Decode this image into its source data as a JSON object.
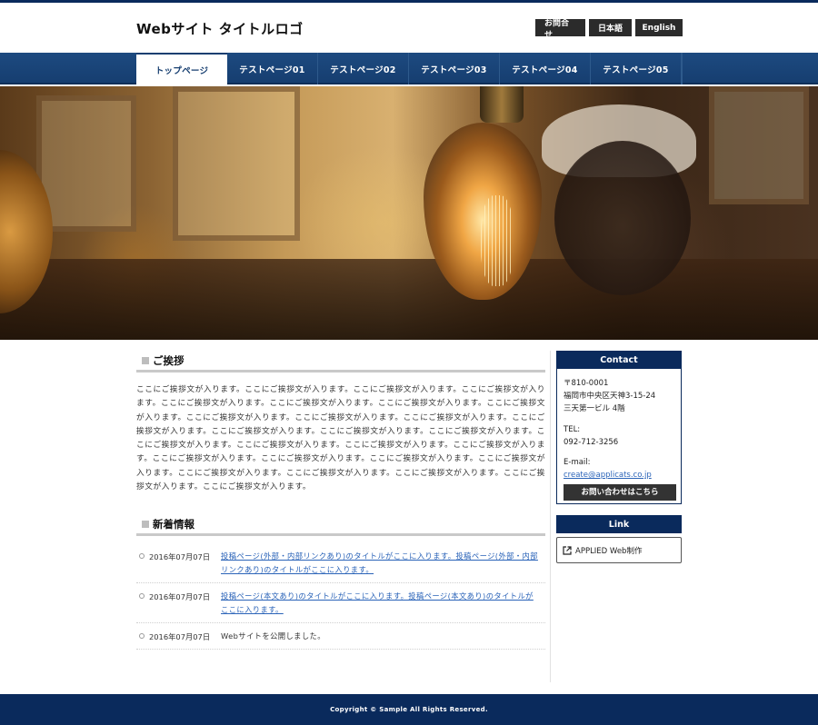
{
  "header": {
    "logo": "Webサイト タイトルロゴ",
    "buttons": [
      "お問合せ",
      "日本語",
      "English"
    ]
  },
  "nav": {
    "items": [
      "トップページ",
      "テストページ01",
      "テストページ02",
      "テストページ03",
      "テストページ04",
      "テストページ05"
    ],
    "active_index": 0
  },
  "greeting": {
    "title": "ご挨拶",
    "body": "ここにご挨拶文が入ります。ここにご挨拶文が入ります。ここにご挨拶文が入ります。ここにご挨拶文が入ります。ここにご挨拶文が入ります。ここにご挨拶文が入ります。ここにご挨拶文が入ります。ここにご挨拶文が入ります。ここにご挨拶文が入ります。ここにご挨拶文が入ります。ここにご挨拶文が入ります。ここにご挨拶文が入ります。ここにご挨拶文が入ります。ここにご挨拶文が入ります。ここにご挨拶文が入ります。ここにご挨拶文が入ります。ここにご挨拶文が入ります。ここにご挨拶文が入ります。ここにご挨拶文が入ります。ここにご挨拶文が入ります。ここにご挨拶文が入ります。ここにご挨拶文が入ります。ここにご挨拶文が入ります。ここにご挨拶文が入ります。ここにご挨拶文が入ります。ここにご挨拶文が入ります。ここにご挨拶文が入ります。ここにご挨拶文が入ります。"
  },
  "news": {
    "title": "新着情報",
    "items": [
      {
        "date": "2016年07月07日",
        "text": "投稿ページ(外部・内部リンクあり)のタイトルがここに入ります。投稿ページ(外部・内部リンクあり)のタイトルがここに入ります。",
        "link": true
      },
      {
        "date": "2016年07月07日",
        "text": "投稿ページ(本文あり)のタイトルがここに入ります。投稿ページ(本文あり)のタイトルがここに入ります。",
        "link": true
      },
      {
        "date": "2016年07月07日",
        "text": "Webサイトを公開しました。",
        "link": false
      }
    ]
  },
  "sidebar": {
    "contact_title": "Contact",
    "postal": "〒810-0001",
    "address1": "福岡市中央区天神3-15-24",
    "address2": "三天第一ビル 4階",
    "tel_label": "TEL:",
    "tel": "092-712-3256",
    "email_label": "E-mail:",
    "email": "create@applicats.co.jp",
    "inquiry_button": "お問い合わせはこちら",
    "link_title": "Link",
    "link_item": "APPLIED Web制作"
  },
  "footer": {
    "copyright": "Copyright © Sample All Rights Reserved."
  },
  "colors": {
    "navy": "#0a2a5c",
    "nav_blue": "#1d4a80",
    "link": "#2a63b8"
  }
}
